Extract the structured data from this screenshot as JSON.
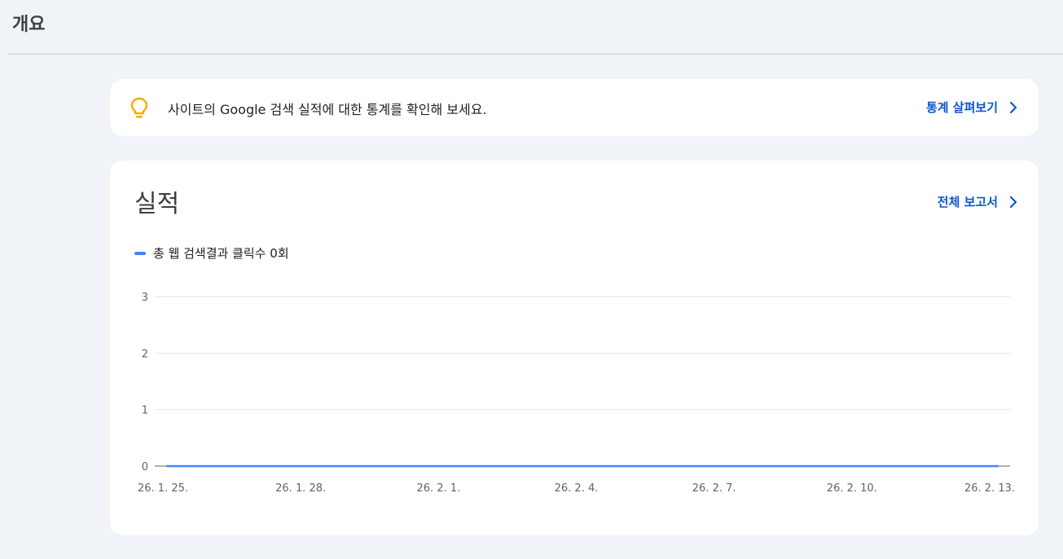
{
  "header": {
    "title": "개요"
  },
  "tip": {
    "icon": "lightbulb-icon",
    "icon_color": "#f9ab00",
    "text": "사이트의 Google 검색 실적에 대한 통계를 확인해 보세요.",
    "link_label": "통계 살펴보기"
  },
  "performance": {
    "title": "실적",
    "link_label": "전체 보고서"
  },
  "colors": {
    "accent": "#0b57d0",
    "series": "#4285f4"
  },
  "chart_data": {
    "type": "line",
    "x": [
      "26. 1. 25.",
      "26. 1. 28.",
      "26. 2. 1.",
      "26. 2. 4.",
      "26. 2. 7.",
      "26. 2. 10.",
      "26. 2. 13."
    ],
    "series": [
      {
        "name": "총 웹 검색결과 클릭수 0회",
        "color": "#4285f4",
        "values": [
          0,
          0,
          0,
          0,
          0,
          0,
          0
        ]
      }
    ],
    "y_ticks": [
      0,
      1,
      2,
      3
    ],
    "ylim": [
      0,
      3
    ],
    "grid": true,
    "legend": "top-left"
  }
}
